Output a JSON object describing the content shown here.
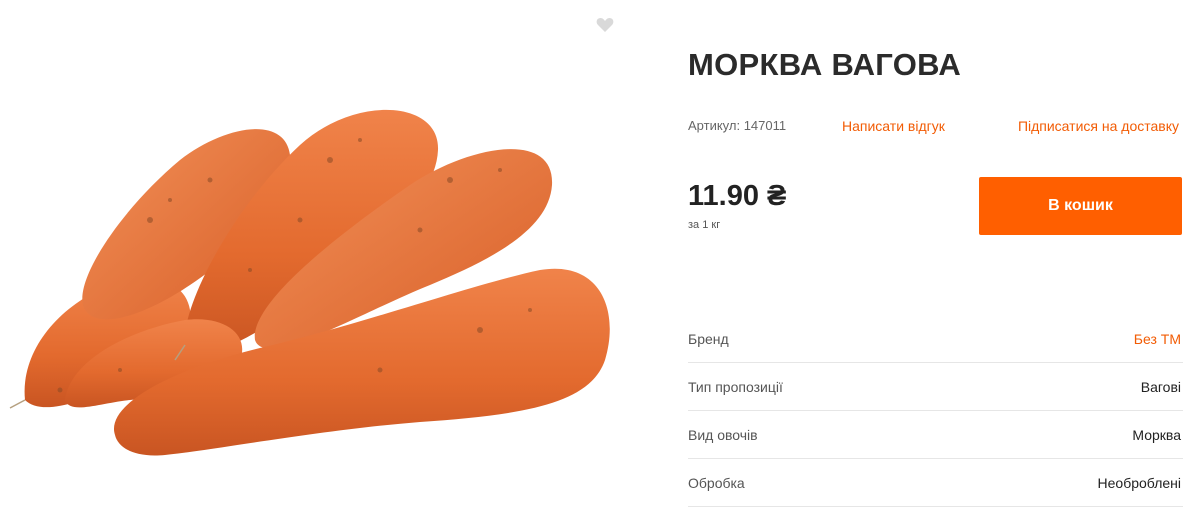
{
  "product": {
    "title": "МОРКВА ВАГОВА",
    "sku_label": "Артикул: 147011",
    "write_review": "Написати відгук",
    "subscribe": "Підписатися на доставку",
    "price": "11.90 ₴",
    "unit": "за 1 кг",
    "add_to_cart": "В кошик",
    "image_icon": "carrots-image",
    "wishlist_icon": "heart-icon"
  },
  "specs": [
    {
      "key": "Бренд",
      "value": "Без ТМ"
    },
    {
      "key": "Тип пропозиції",
      "value": "Вагові"
    },
    {
      "key": "Вид овочів",
      "value": "Морква"
    },
    {
      "key": "Обробка",
      "value": "Необроблені"
    }
  ],
  "colors": {
    "accent": "#ff5f00",
    "link": "#f25c05",
    "carrot": "#e8733a",
    "wishlist": "#d9d9d9"
  }
}
